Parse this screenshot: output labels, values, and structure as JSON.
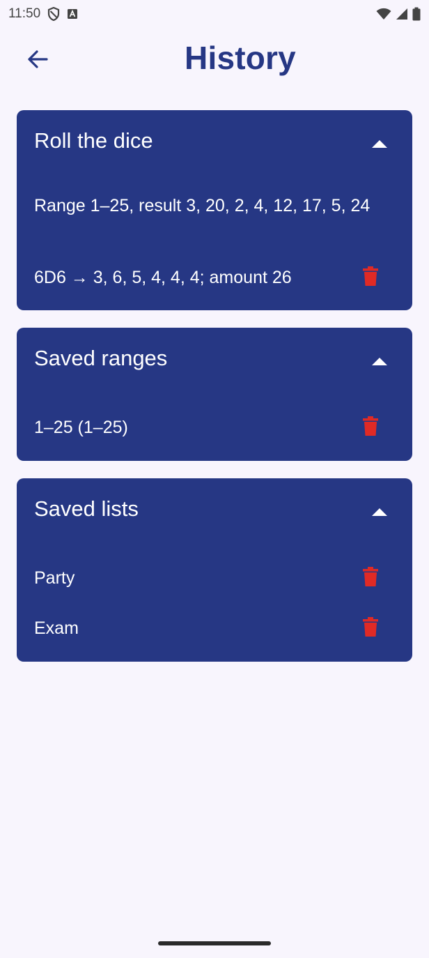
{
  "status_bar": {
    "time": "11:50",
    "icons": [
      "shield-icon",
      "keyboard-a-icon",
      "wifi-icon",
      "signal-icon",
      "battery-icon"
    ]
  },
  "header": {
    "title": "History",
    "back_icon": "arrow-left-icon"
  },
  "sections": {
    "roll": {
      "title": "Roll the dice",
      "expanded": true,
      "entries": [
        {
          "text": "Range 1–25, result 3, 20, 2, 4, 12, 17, 5, 24"
        },
        {
          "text": "6D6 → 3, 6, 5, 4, 4, 4; amount 26"
        }
      ]
    },
    "ranges": {
      "title": "Saved ranges",
      "expanded": true,
      "entries": [
        {
          "text": "1–25 (1–25)"
        }
      ]
    },
    "lists": {
      "title": "Saved lists",
      "expanded": true,
      "entries": [
        {
          "text": "Party"
        },
        {
          "text": "Exam"
        }
      ]
    }
  },
  "colors": {
    "background": "#f8f5fd",
    "card": "#263784",
    "title": "#263784",
    "delete": "#e02a25",
    "text_on_card": "#ffffff"
  }
}
